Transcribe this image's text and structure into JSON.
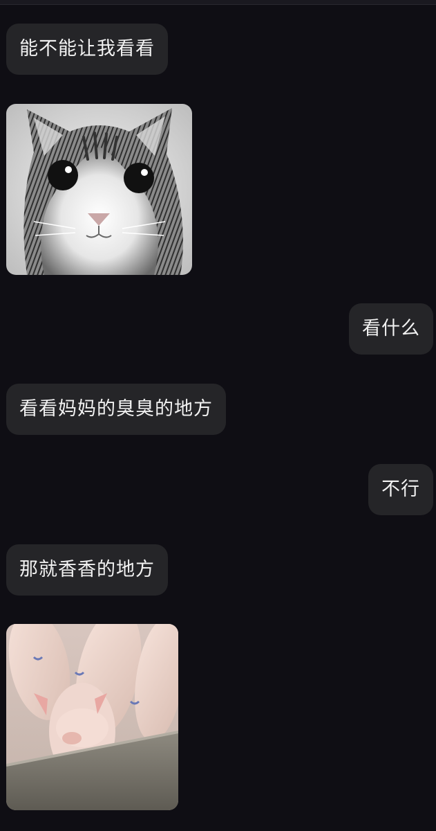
{
  "messages": [
    {
      "side": "left",
      "type": "text",
      "text": "能不能让我看看"
    },
    {
      "side": "left",
      "type": "sticker",
      "icon": "cat-face-sticker"
    },
    {
      "side": "right",
      "type": "text",
      "text": "看什么"
    },
    {
      "side": "left",
      "type": "text",
      "text": "看看妈妈的臭臭的地方"
    },
    {
      "side": "right",
      "type": "text",
      "text": "不行"
    },
    {
      "side": "left",
      "type": "text",
      "text": "那就香香的地方"
    },
    {
      "side": "left",
      "type": "sticker",
      "icon": "pigs-sticker"
    }
  ],
  "colors": {
    "background": "#0f0e14",
    "bubble": "#252528",
    "text": "#f2f2f2"
  }
}
